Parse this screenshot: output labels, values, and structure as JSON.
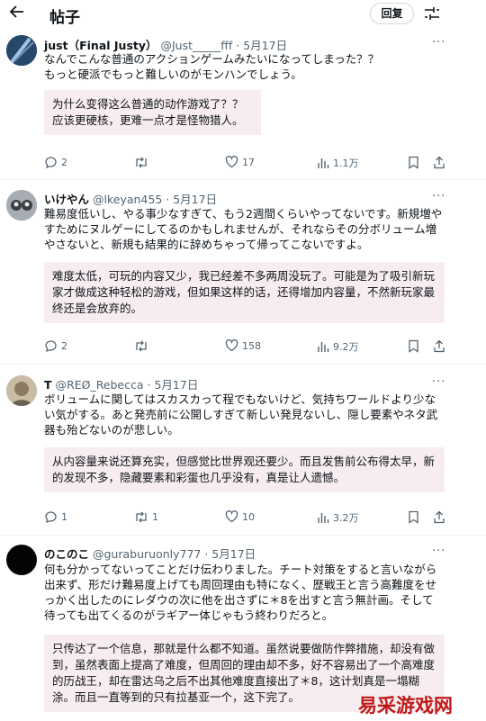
{
  "header": {
    "title": "帖子",
    "reply_label": "回复"
  },
  "posts": [
    {
      "name": "just（Final Justy）",
      "handle": "@Just_____fff",
      "date": "· 5月17日",
      "text": "なんでこんな普通のアクションゲームみたいになってしまった？？\nもっと硬派でもっと難しいのがモンハンでしょう。",
      "translation": "为什么变得这么普通的动作游戏了？？\n应该更硬核，更难一点才是怪物猎人。",
      "stats": {
        "replies": "2",
        "retweets": "",
        "likes": "17",
        "views": "1.1万"
      }
    },
    {
      "name": "いけやん",
      "handle": "@lkeyan455",
      "date": "· 5月17日",
      "text": "難易度低いし、やる事少なすぎて、もう2週間くらいやってないです。新規増やすためにヌルゲーにしてるのかもしれませんが、それならその分ボリューム増やさないと、新規も結果的に辞めちゃって帰ってこないですよ。",
      "translation": "难度太低，可玩的内容又少，我已经差不多两周没玩了。可能是为了吸引新玩家才做成这种轻松的游戏，但如果这样的话，还得增加内容量，不然新玩家最终还是会放弃的。",
      "stats": {
        "replies": "2",
        "retweets": "",
        "likes": "158",
        "views": "9.2万"
      }
    },
    {
      "name": "T",
      "handle": "@REØ_Rebecca",
      "date": "· 5月17日",
      "text": "ボリュームに関してはスカスカって程でもないけど、気持ちワールドより少ない気がする。あと発売前に公開しすぎて新しい発見ないし、隠し要素やネタ武器も殆どないのが悲しい。",
      "translation": "从内容量来说还算充实，但感觉比世界观还要少。而且发售前公布得太早，新的发现不多，隐藏要素和彩蛋也几乎没有，真是让人遗憾。",
      "stats": {
        "replies": "1",
        "retweets": "1",
        "likes": "10",
        "views": "3.2万"
      }
    },
    {
      "name": "のこのこ",
      "handle": "@guraburuonly777",
      "date": "· 5月17日",
      "text": "何も分かってないってことだけ伝わりました。チート対策をすると言いながら出来ず、形だけ難易度上げても周回理由も特になく、歴戦王と言う高難度をせっかく出したのにレダウの次に他を出さずに＊8を出すと言う無計画。そして待っても出てくるのがラギアー体じゃもう終わりだろと。",
      "translation": "只传达了一个信息，那就是什么都不知道。虽然说要做防作弊措施，却没有做到，虽然表面上提高了难度，但周回的理由却不多，好不容易出了一个高难度的历战王，却在雷达乌之后不出其他难度直接出了＊8，这计划真是一塌糊涂。而且一直等到的只有拉基亚一个，这下完了。",
      "stats": {
        "replies": "",
        "retweets": "",
        "likes": "",
        "views": ""
      }
    }
  ],
  "watermark": "易采游戏网",
  "colors": {
    "text": "#0f1419",
    "secondary": "#536471",
    "translation_bg": "#f7edf0",
    "watermark": "#c01818"
  }
}
